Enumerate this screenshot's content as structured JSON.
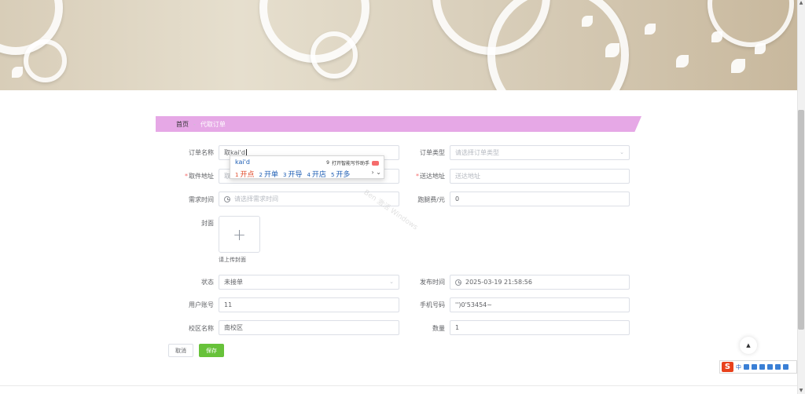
{
  "breadcrumb": {
    "home": "首页",
    "separator": "-",
    "current": "代取订单"
  },
  "form": {
    "order_name": {
      "label": "订单名称",
      "value": "取kai'd"
    },
    "order_type": {
      "label": "订单类型",
      "placeholder": "请选择订单类型"
    },
    "pickup_address": {
      "label": "取件地址",
      "value": "取"
    },
    "delivery_address": {
      "label": "送达地址",
      "placeholder": "送达地址"
    },
    "demand_time": {
      "label": "需求时间",
      "placeholder": "请选择需求时间"
    },
    "errand_fee": {
      "label": "跑腿费/元",
      "value": "0"
    },
    "cover": {
      "label": "封面",
      "upload_tip": "请上传封面",
      "upload_symbol": "+"
    },
    "status": {
      "label": "状态",
      "value": "未接单"
    },
    "publish_time": {
      "label": "发布时间",
      "value": "2025-03-19 21:58:56"
    },
    "user_account": {
      "label": "用户账号",
      "value": "11"
    },
    "phone": {
      "label": "手机号码",
      "value": "'')0'53454~"
    },
    "campus": {
      "label": "校区名称",
      "value": "南校区"
    },
    "quantity": {
      "label": "数量",
      "value": "1"
    },
    "required_marker": "*"
  },
  "buttons": {
    "cancel": "取消",
    "save": "保存"
  },
  "ime_popup": {
    "composition": "kai'd",
    "tip_number": "9",
    "tip": "打开智能写作助手",
    "candidates": [
      {
        "num": "1",
        "text": "开点"
      },
      {
        "num": "2",
        "text": "开单"
      },
      {
        "num": "3",
        "text": "开导"
      },
      {
        "num": "4",
        "text": "开店"
      },
      {
        "num": "5",
        "text": "开多"
      }
    ],
    "nav": "› ⌄"
  },
  "watermark": "Ben 激活 Windows",
  "ime_toolbar": {
    "logo": "S",
    "mode": "中"
  },
  "icons": [
    "clock-icon",
    "chevron-down-icon",
    "plus-icon",
    "back-to-top-icon",
    "scroll-up-icon",
    "scroll-down-icon"
  ],
  "colors": {
    "breadcrumb_bg": "#e6a8e6",
    "save_button": "#67c23a",
    "required": "#f56c6c"
  }
}
